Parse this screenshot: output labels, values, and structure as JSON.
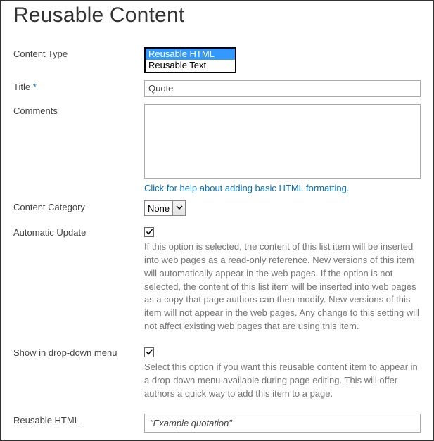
{
  "header": {
    "title": "Reusable Content"
  },
  "labels": {
    "content_type": "Content Type",
    "title": "Title",
    "comments": "Comments",
    "content_category": "Content Category",
    "automatic_update": "Automatic Update",
    "show_in_dropdown": "Show in drop-down menu",
    "reusable_html": "Reusable HTML"
  },
  "required_mark": "*",
  "content_type": {
    "options": [
      "Reusable HTML",
      "Reusable Text"
    ],
    "selected_index": 0
  },
  "title_field": {
    "value": "Quote"
  },
  "comments_field": {
    "value": ""
  },
  "help_link": "Click for help about adding basic HTML formatting.",
  "content_category": {
    "selected": "None"
  },
  "automatic_update": {
    "checked": true,
    "description": "If this option is selected, the content of this list item will be inserted into web pages as a read-only reference. New versions of this item will automatically appear in the web pages. If the option is not selected, the content of this list item will be inserted into web pages as a copy that page authors can then modify. New versions of this item will not appear in the web pages. Any change to this setting will not affect existing web pages that are using this item."
  },
  "show_in_dropdown": {
    "checked": true,
    "description": "Select this option if you want this reusable content item to appear in a drop-down menu available during page editing. This will offer authors a quick way to add this item to a page."
  },
  "reusable_html_field": {
    "value": "\"Example quotation\""
  }
}
